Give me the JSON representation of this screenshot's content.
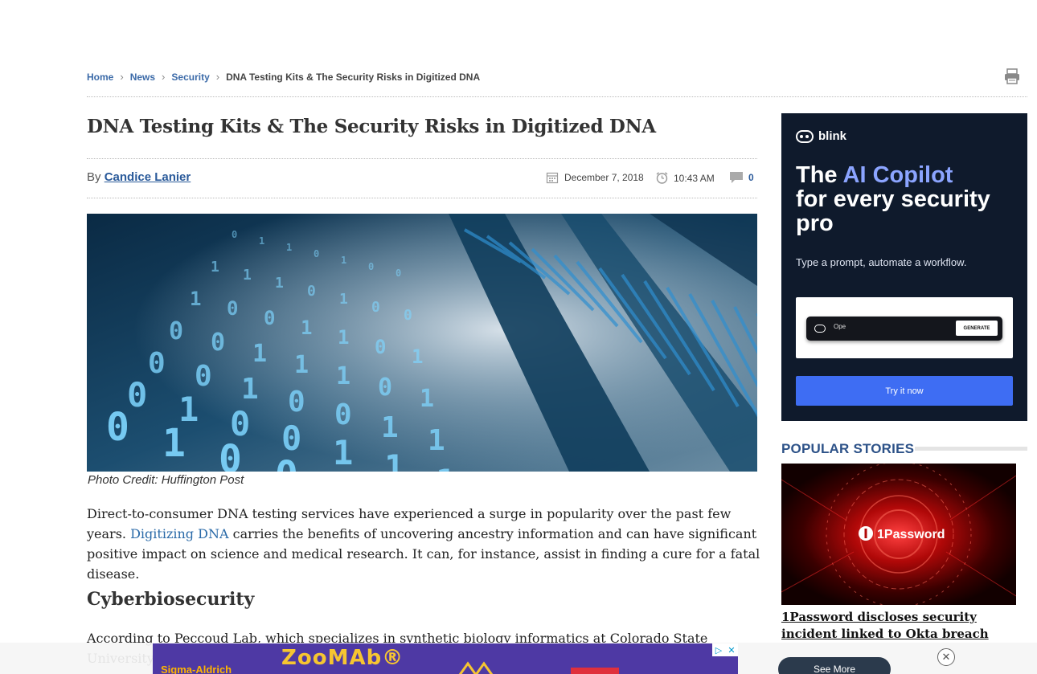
{
  "breadcrumb": {
    "home": "Home",
    "news": "News",
    "security": "Security",
    "current": "DNA Testing Kits & The Security Risks in Digitized DNA"
  },
  "article": {
    "title": "DNA Testing Kits & The Security Risks in Digitized DNA",
    "by_label": "By",
    "author": "Candice Lanier",
    "date": "December 7, 2018",
    "time": "10:43 AM",
    "comments": "0",
    "image_caption": "Photo Credit: Huffington Post",
    "para1_before": "Direct-to-consumer DNA testing services have experienced a surge in popularity over the past few years.",
    "para1_link": "Digitizing DNA",
    "para1_after": " carries the benefits of uncovering ancestry information and can have significant positive impact on science and medical research. It can, for instance, assist in finding a cure for a fatal disease.",
    "heading": "Cyberbiosecurity",
    "para2": "According to Peccoud Lab, which specializes in synthetic biology informatics at Colorado State University"
  },
  "hero_binary": [
    "0",
    "1",
    "1",
    "0",
    "1",
    "0",
    "0",
    "1",
    "1",
    "1",
    "0",
    "1",
    "0",
    "0",
    "1",
    "0"
  ],
  "ad": {
    "brand": "blink",
    "headline_1": "The ",
    "headline_accent": "AI Copilot",
    "headline_2": "for every security pro",
    "sub": "Type a prompt, automate a workflow.",
    "input_text": "Ope",
    "generate": "GENERATE",
    "cta": "Try it now"
  },
  "sidebar": {
    "popular_title": "POPULAR STORIES",
    "story_image_text": "1Password",
    "story_title": "1Password discloses security incident linked to Okta breach"
  },
  "bottom_ad": {
    "banner_text": "ZooMAb®",
    "side_text": "Sigma-Aldrich",
    "see_more": "See More"
  },
  "colors": {
    "link_blue": "#2a5a9a",
    "ad_bg": "#0f1a2c",
    "ad_cta": "#3e6df3",
    "popular_title": "#2d5288"
  }
}
